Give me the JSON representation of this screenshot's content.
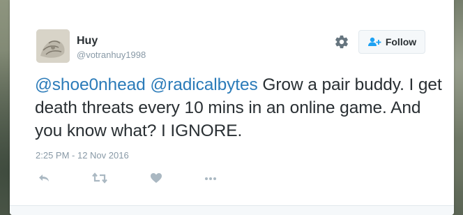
{
  "user": {
    "name": "Huy",
    "handle": "@votranhuy1998"
  },
  "follow_button": {
    "label": "Follow"
  },
  "tweet": {
    "mention_1": "@shoe0nhead",
    "mention_2": "@radicalbytes",
    "text": "Grow a pair buddy. I get death threats every 10 mins in an online game. And you know what? I IGNORE."
  },
  "timestamp": "2:25 PM - 12 Nov 2016",
  "icons": {
    "settings": "gear-icon",
    "follow": "add-user-icon",
    "reply": "reply-icon",
    "retweet": "retweet-icon",
    "like": "heart-icon",
    "more": "more-icon"
  },
  "colors": {
    "link": "#2b7bb9",
    "text": "#292f33",
    "muted": "#8899a6",
    "follow_icon": "#1da1f2",
    "action_icon": "#aab8c2"
  }
}
